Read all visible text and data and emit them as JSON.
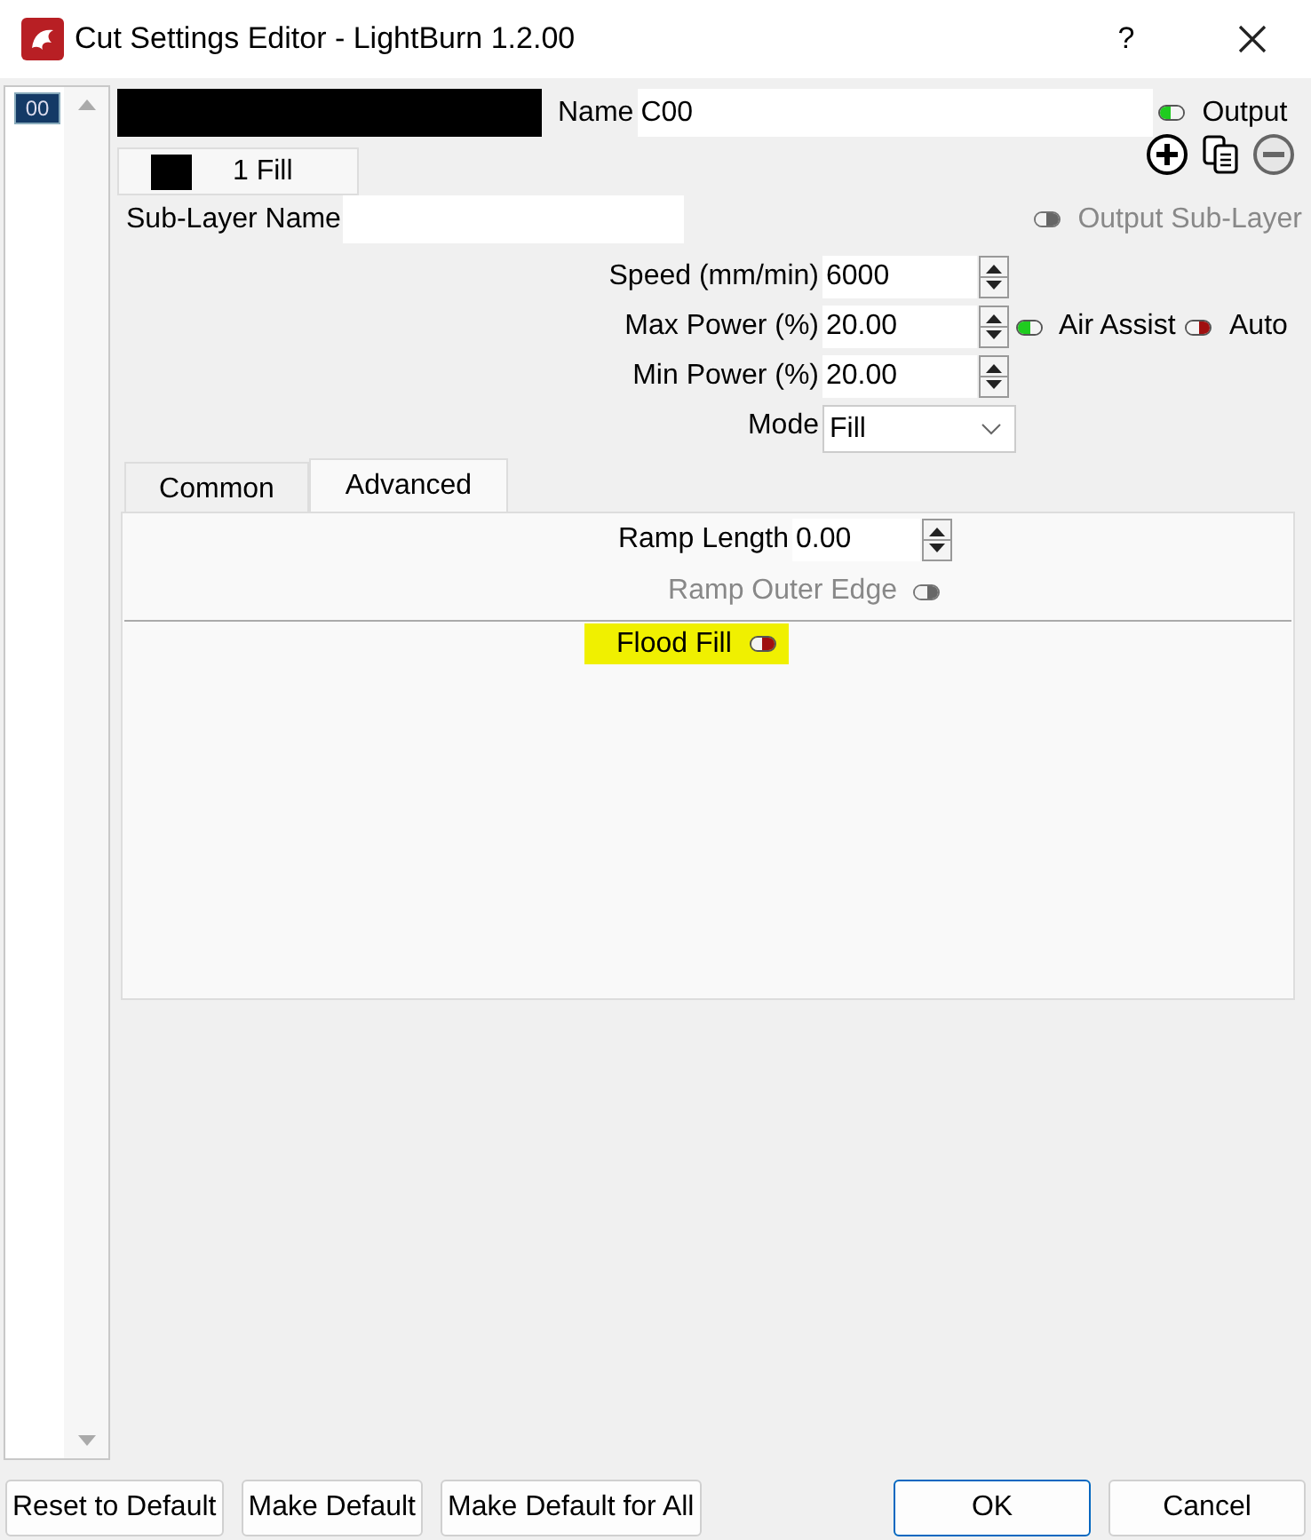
{
  "window": {
    "title": "Cut Settings Editor - LightBurn 1.2.00",
    "help": "?"
  },
  "layer_list": {
    "items": [
      {
        "label": "00",
        "selected": true
      }
    ]
  },
  "layer": {
    "name_label": "Name",
    "name": "C00",
    "output": {
      "label": "Output",
      "on": true
    }
  },
  "sublayer_tabs": [
    {
      "label": "1 Fill",
      "selected": true
    }
  ],
  "sublayer_name": {
    "label": "Sub-Layer Name"
  },
  "output_sublayer": {
    "label": "Output Sub-Layer",
    "on": false,
    "disabled": true
  },
  "settings": [
    {
      "kind": "spin",
      "label": "Speed (mm/min)",
      "value": "6000"
    },
    {
      "kind": "spin",
      "label": "Max Power (%)",
      "value": "20.00",
      "toggles": [
        {
          "label": "Air Assist",
          "on": true
        },
        {
          "label": "Auto",
          "on": false
        }
      ]
    },
    {
      "kind": "spin",
      "label": "Min Power (%)",
      "value": "20.00"
    },
    {
      "kind": "select",
      "label": "Mode",
      "value": "Fill"
    }
  ],
  "tabs": [
    {
      "label": "Common",
      "selected": false
    },
    {
      "label": "Advanced",
      "selected": true
    }
  ],
  "advanced": {
    "fields": [
      {
        "kind": "spin",
        "label": "Ramp Length",
        "value": "0.00"
      },
      {
        "kind": "toggle",
        "label": "Ramp Outer Edge",
        "on": false,
        "disabled": true
      }
    ],
    "flood_fill": {
      "label": "Flood Fill",
      "on": false,
      "highlighted": true
    }
  },
  "buttons": [
    {
      "label": "Reset to Default",
      "default": false
    },
    {
      "label": "Make Default",
      "default": false
    },
    {
      "label": "Make Default for All",
      "default": false
    },
    {
      "label": "OK",
      "default": true
    },
    {
      "label": "Cancel",
      "default": false
    }
  ]
}
